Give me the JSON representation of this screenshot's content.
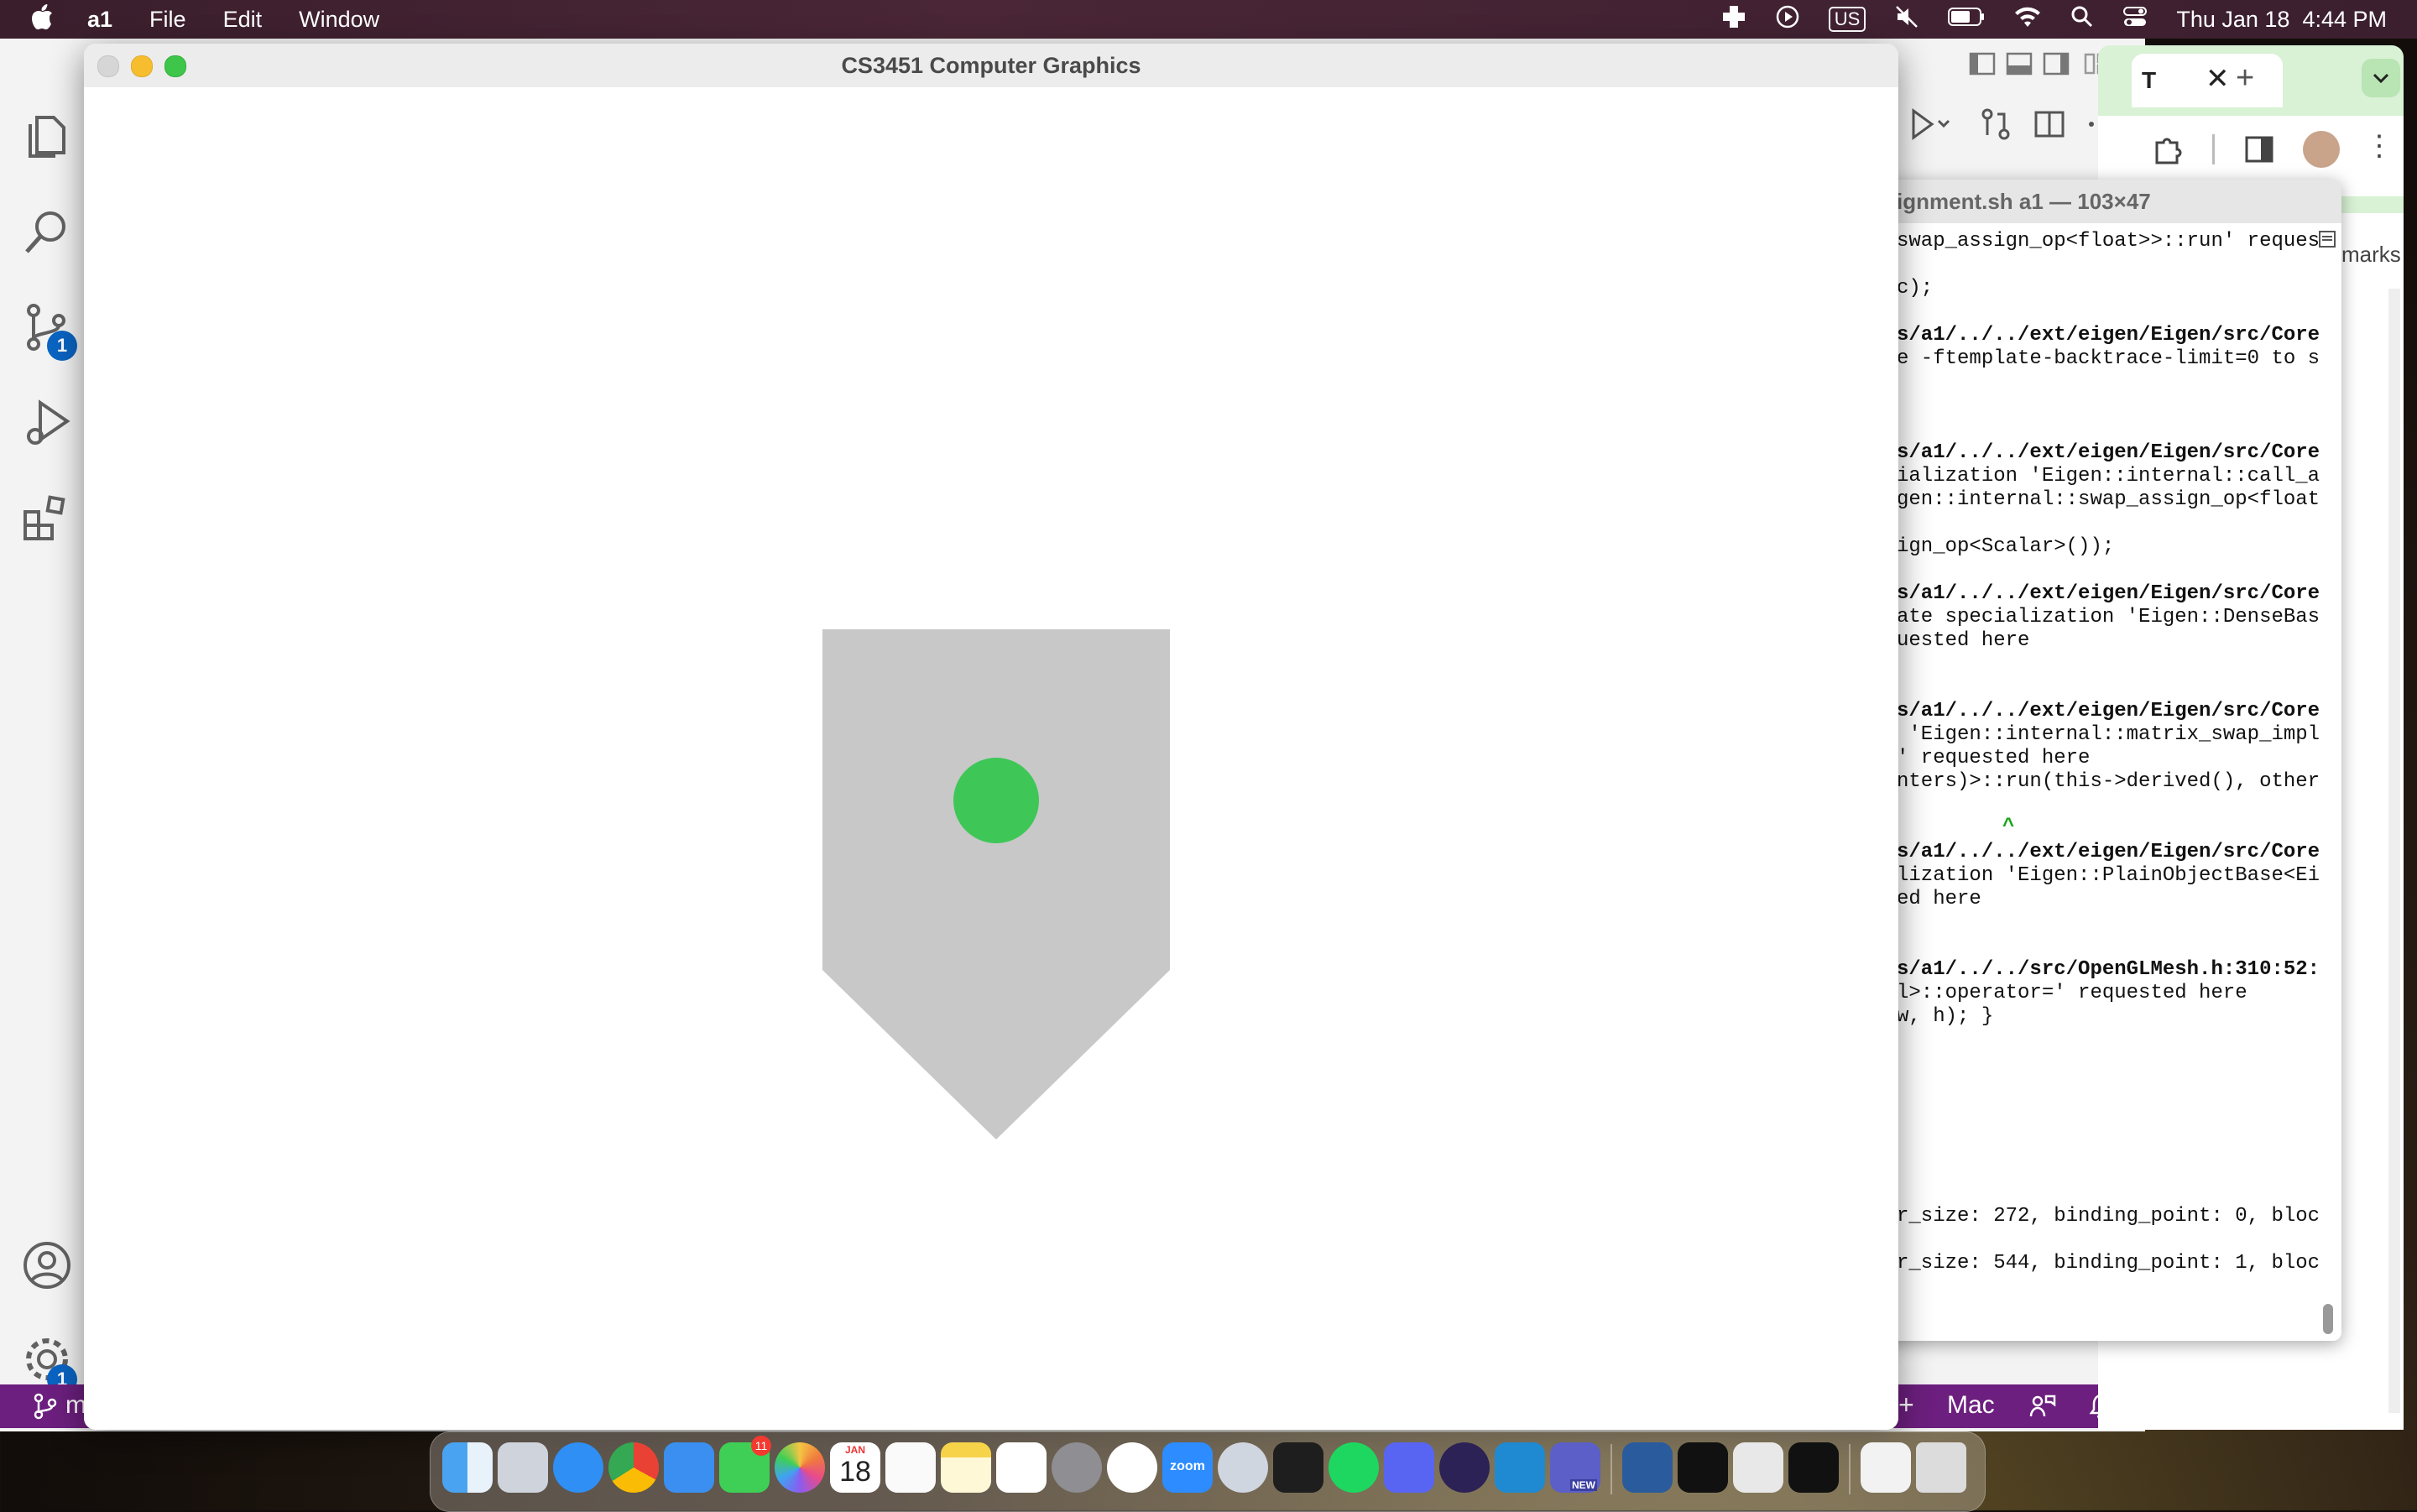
{
  "menubar": {
    "app_name": "a1",
    "menus": [
      "File",
      "Edit",
      "Window"
    ],
    "input_source": "US",
    "datetime": "Thu Jan 18  4:44 PM"
  },
  "window": {
    "title": "CS3451 Computer Graphics"
  },
  "vscode": {
    "scm_badge": "1",
    "settings_badge": "1",
    "status_platform": "Mac",
    "status_left": "m"
  },
  "browser": {
    "tab_label": "T",
    "bookmarks_fragment": "marks"
  },
  "terminal": {
    "title": "ignment.sh a1 — 103×47",
    "lines": [
      "swap_assign_op<float>>::run' reques",
      "c);",
      "s/a1/../../ext/eigen/Eigen/src/Core",
      "e -ftemplate-backtrace-limit=0 to s",
      "s/a1/../../ext/eigen/Eigen/src/Core",
      "ialization 'Eigen::internal::call_a",
      "gen::internal::swap_assign_op<float",
      "ign_op<Scalar>());",
      "s/a1/../../ext/eigen/Eigen/src/Core",
      "ate specialization 'Eigen::DenseBas",
      "uested here",
      "s/a1/../../ext/eigen/Eigen/src/Core",
      " 'Eigen::internal::matrix_swap_impl",
      "' requested here",
      "nters)>::run(this->derived(), other",
      "^",
      "s/a1/../../ext/eigen/Eigen/src/Core",
      "lization 'Eigen::PlainObjectBase<Ei",
      "ed here",
      "s/a1/../../src/OpenGLMesh.h:310:52:",
      "l>::operator=' requested here",
      "w, h); }",
      "r_size: 272, binding_point: 0, bloc",
      "r_size: 544, binding_point: 1, bloc"
    ]
  },
  "scene": {
    "shield_color": "#c8c8c8",
    "dot_color": "#3ec757"
  },
  "dock": {
    "calendar_month": "JAN",
    "calendar_day": "18",
    "messages_badge": "11",
    "zoom_label": "zoom",
    "teams_badge": "NEW"
  }
}
